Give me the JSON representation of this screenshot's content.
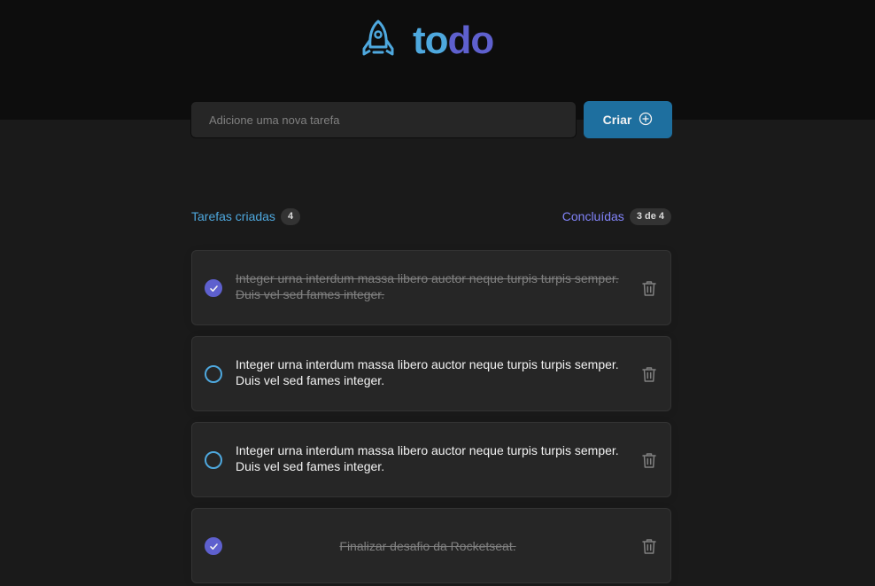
{
  "app": {
    "logo_text_part1": "to",
    "logo_text_part2": "do",
    "logo_icon": "rocket-icon"
  },
  "new_task": {
    "placeholder": "Adicione uma nova tarefa",
    "value": ""
  },
  "create_button": {
    "label": "Criar",
    "icon": "plus-circle-icon"
  },
  "counters": {
    "created_label": "Tarefas criadas",
    "created_count": "4",
    "done_label": "Concluídas",
    "done_count": "3 de 4"
  },
  "tasks": [
    {
      "text": "Integer urna interdum massa libero auctor neque turpis turpis semper. Duis vel sed fames integer.",
      "done": true
    },
    {
      "text": "Integer urna interdum massa libero auctor neque turpis turpis semper. Duis vel sed fames integer.",
      "done": false
    },
    {
      "text": "Integer urna interdum massa libero auctor neque turpis turpis semper. Duis vel sed fames integer.",
      "done": false
    },
    {
      "text": "Finalizar desafio da Rocketseat.",
      "done": true
    }
  ],
  "colors": {
    "blue": "#4ea8de",
    "blue_dark": "#1e6f9f",
    "purple": "#5e60ce",
    "purple_light": "#8284fa",
    "background": "#1a1a1a",
    "header_background": "#0d0d0d"
  }
}
